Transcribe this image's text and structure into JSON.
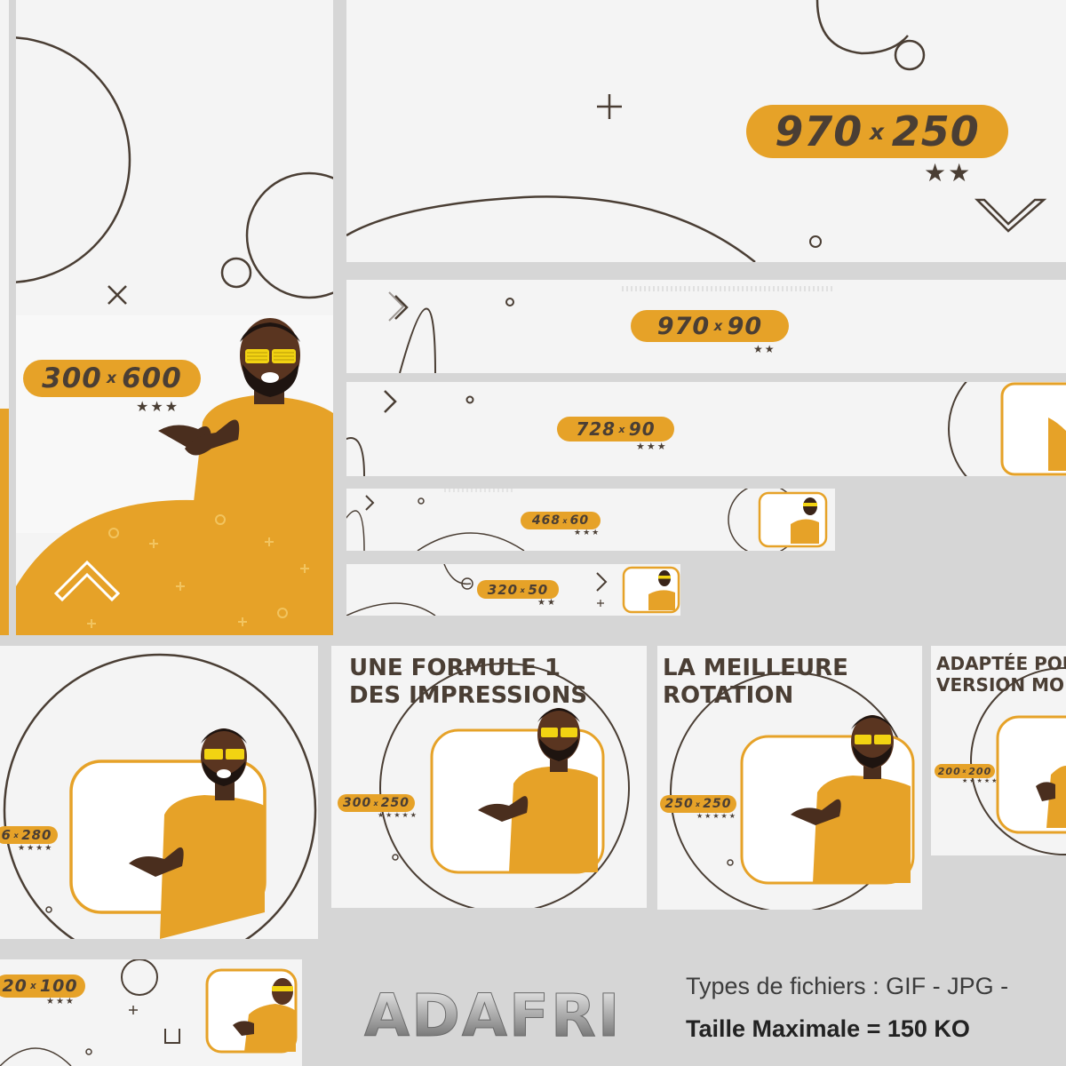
{
  "banners": {
    "b970x250": {
      "w": "970",
      "h": "250",
      "sep": "x",
      "stars": "★★"
    },
    "b300x600": {
      "w": "300",
      "h": "600",
      "sep": "x",
      "stars": "★★★"
    },
    "b970x90": {
      "w": "970",
      "h": "90",
      "sep": "x",
      "stars": "★★"
    },
    "b728x90": {
      "w": "728",
      "h": "90",
      "sep": "x",
      "stars": "★★★"
    },
    "b468x60": {
      "w": "468",
      "h": "60",
      "sep": "x",
      "stars": "★★★"
    },
    "b320x50": {
      "w": "320",
      "h": "50",
      "sep": "x",
      "stars": "★★"
    },
    "b336x280": {
      "w": "6",
      "h": "280",
      "sep": "x",
      "stars": "★★★★"
    },
    "b300x250": {
      "w": "300",
      "h": "250",
      "sep": "x",
      "stars": "★★★★★",
      "headline1": "UNE FORMULE 1",
      "headline2": "DES IMPRESSIONS"
    },
    "b250x250": {
      "w": "250",
      "h": "250",
      "sep": "x",
      "stars": "★★★★★",
      "headline1": "LA MEILLEURE",
      "headline2": "ROTATION"
    },
    "b200x200": {
      "w": "200",
      "h": "200",
      "sep": "x",
      "stars": "★★★★★",
      "headline1": "ADAPTÉE POU",
      "headline2": "VERSION MO"
    },
    "b320x100": {
      "w": "20",
      "h": "100",
      "sep": "x",
      "stars": "★★★"
    }
  },
  "brand": {
    "logo_text": "ADAFRI"
  },
  "info": {
    "file_types": "Types de fichiers : GIF - JPG -",
    "max_size": "Taille Maximale = 150 KO"
  },
  "colors": {
    "accent": "#e6a228",
    "dark": "#4a3e34",
    "card": "#f4f4f4",
    "background": "#d6d6d6"
  }
}
